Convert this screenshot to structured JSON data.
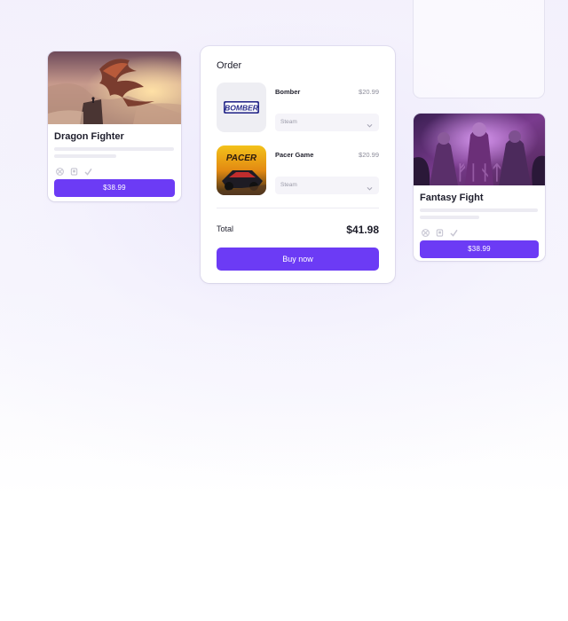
{
  "colors": {
    "accent": "#6c3bf5",
    "background": "#f4f2fc",
    "card": "#ffffff",
    "skeleton": "#ecebf2"
  },
  "cards": [
    {
      "title": "Dragon Fighter",
      "price_label": "$38.99",
      "cover_art": "dragon-artwork",
      "platform_icons": [
        "xbox-icon",
        "playstation-icon",
        "nintendo-icon"
      ]
    },
    {
      "title": "Fantasy Fight",
      "price_label": "$38.99",
      "cover_art": "fantasy-artwork",
      "platform_icons": [
        "xbox-icon",
        "playstation-icon",
        "nintendo-icon"
      ]
    }
  ],
  "order": {
    "title": "Order",
    "items": [
      {
        "name": "Bomber",
        "price": "$20.99",
        "logo_text": "BOMBER",
        "platform": "Steam"
      },
      {
        "name": "Pacer Game",
        "price": "$20.99",
        "logo_text": "PACER",
        "platform": "Steam"
      }
    ],
    "total_label": "Total",
    "total_value": "$41.98",
    "buy_label": "Buy now"
  }
}
